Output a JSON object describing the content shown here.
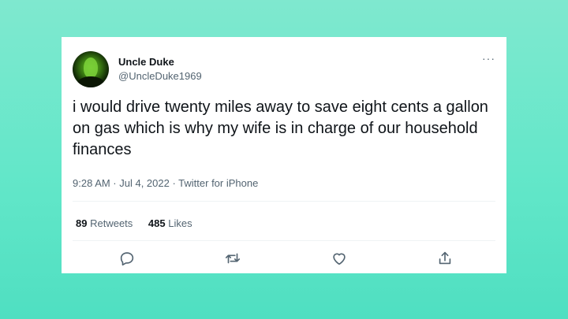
{
  "tweet": {
    "display_name": "Uncle Duke",
    "handle": "@UncleDuke1969",
    "text": "i would drive twenty miles away to save eight cents a gallon on gas which is why my wife is in charge of our household finances",
    "meta": "9:28 AM · Jul 4, 2022 · Twitter for iPhone",
    "retweets_count": "89",
    "retweets_label": "Retweets",
    "likes_count": "485",
    "likes_label": "Likes",
    "more_label": "···"
  },
  "icons": {
    "reply": "reply-icon",
    "retweet": "retweet-icon",
    "like": "like-icon",
    "share": "share-icon"
  },
  "colors": {
    "background": "#63e7c9",
    "card": "#ffffff",
    "primary_text": "#0f1419",
    "secondary_text": "#536471"
  }
}
